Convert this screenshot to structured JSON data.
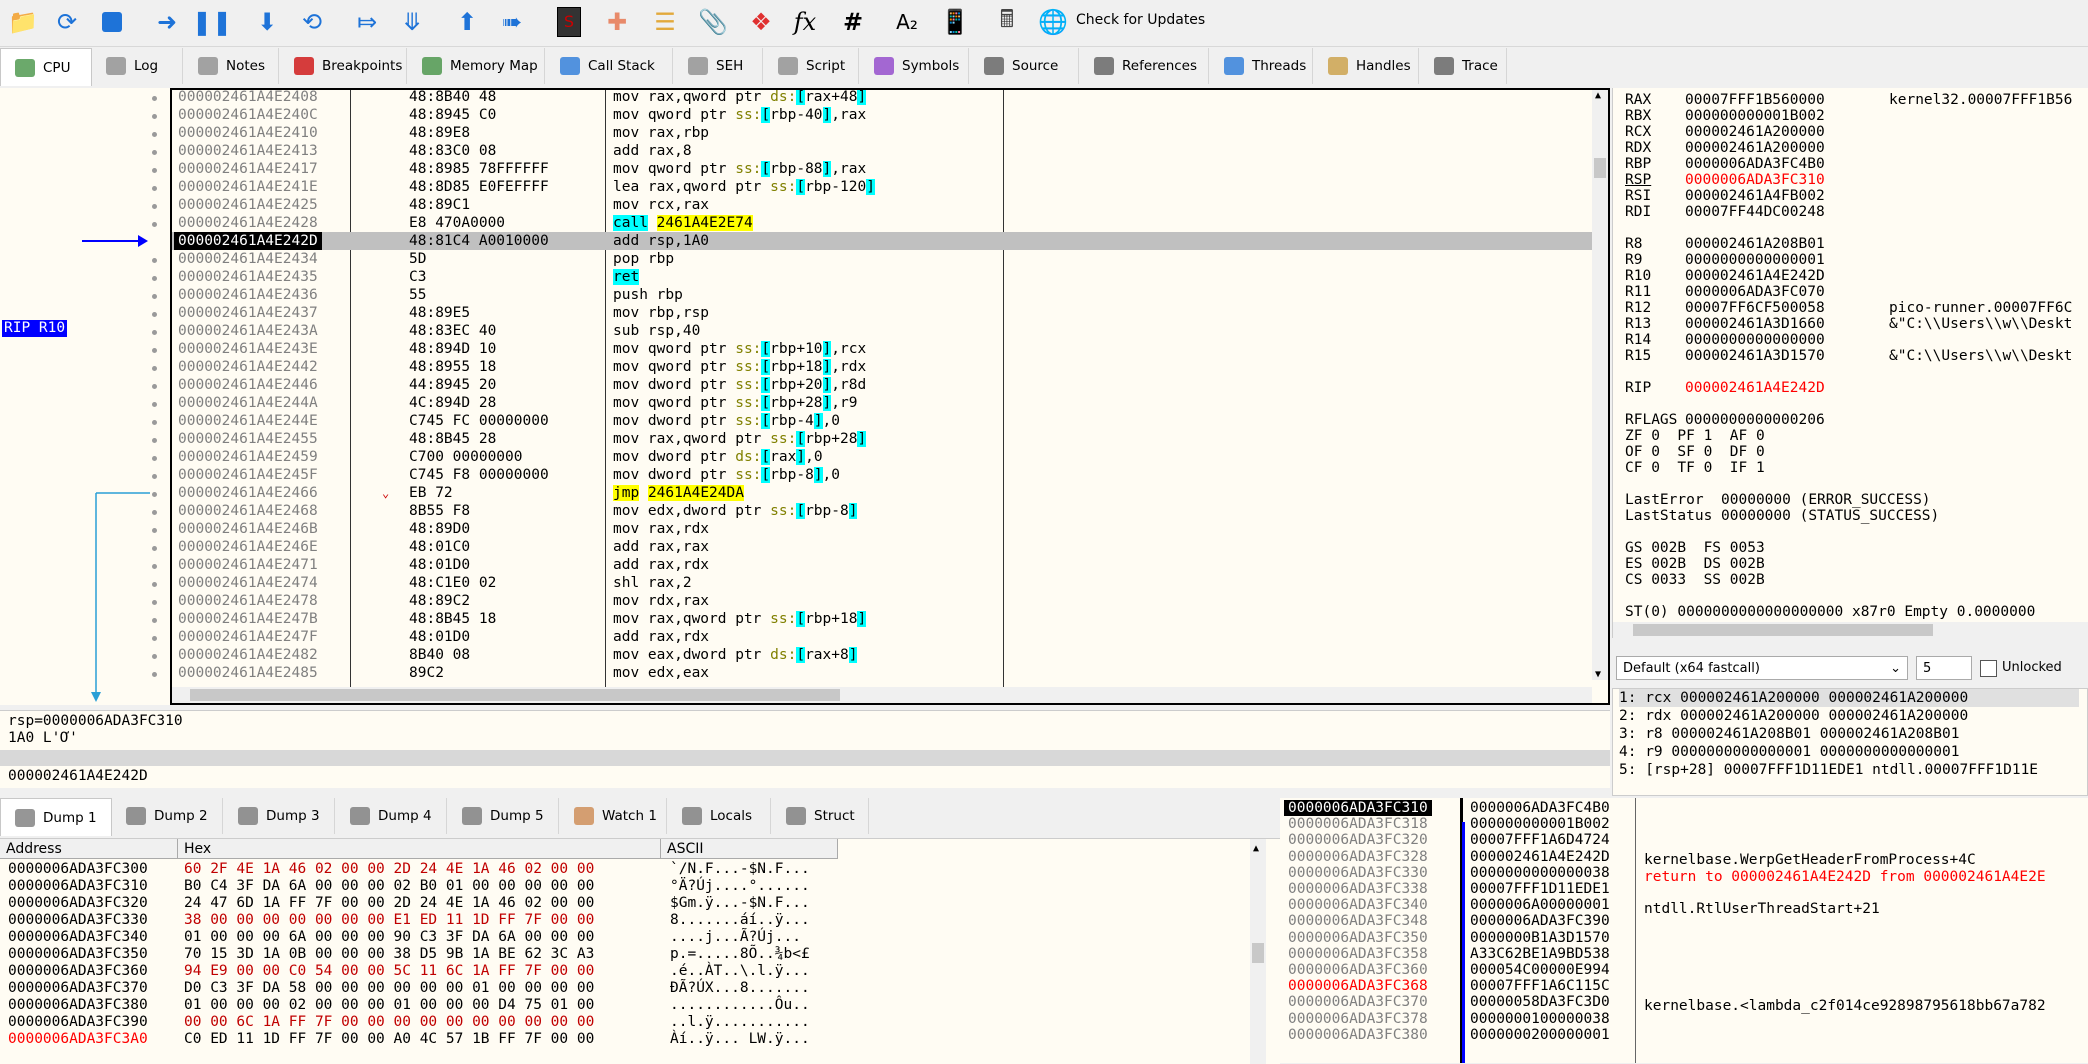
{
  "toolbar": {
    "check_updates_label": "Check for Updates",
    "icons": [
      "open-icon",
      "restart-icon",
      "stop-icon",
      "run-icon",
      "pause-icon",
      "step-into-icon",
      "step-over-icon",
      "trace-into-icon",
      "trace-over-icon",
      "execute-till-return-icon",
      "run-to-user-code-icon",
      "scylla-icon",
      "patches-icon",
      "comments-icon",
      "labels-icon",
      "bookmarks-icon",
      "functions-icon",
      "hash-icon",
      "font-icon",
      "calculator-icon",
      "update-icon"
    ]
  },
  "tabs": [
    {
      "label": "CPU",
      "icon": "cpu-icon",
      "active": true
    },
    {
      "label": "Log",
      "icon": "log-icon"
    },
    {
      "label": "Notes",
      "icon": "notes-icon"
    },
    {
      "label": "Breakpoints",
      "icon": "breakpoint-icon"
    },
    {
      "label": "Memory Map",
      "icon": "memory-map-icon"
    },
    {
      "label": "Call Stack",
      "icon": "call-stack-icon"
    },
    {
      "label": "SEH",
      "icon": "seh-icon"
    },
    {
      "label": "Script",
      "icon": "script-icon"
    },
    {
      "label": "Symbols",
      "icon": "symbols-icon"
    },
    {
      "label": "Source",
      "icon": "source-icon"
    },
    {
      "label": "References",
      "icon": "references-icon"
    },
    {
      "label": "Threads",
      "icon": "threads-icon"
    },
    {
      "label": "Handles",
      "icon": "handles-icon"
    },
    {
      "label": "Trace",
      "icon": "trace-icon"
    }
  ],
  "rip_label": "RIP R10",
  "disasm": [
    {
      "addr": "000002461A4E2408",
      "bytes": "48:8B40 48",
      "ins": "mov rax,qword ptr ds:[rax+48]"
    },
    {
      "addr": "000002461A4E240C",
      "bytes": "48:8945 C0",
      "ins": "mov qword ptr ss:[rbp-40],rax"
    },
    {
      "addr": "000002461A4E2410",
      "bytes": "48:89E8",
      "ins": "mov rax,rbp"
    },
    {
      "addr": "000002461A4E2413",
      "bytes": "48:83C0 08",
      "ins": "add rax,8"
    },
    {
      "addr": "000002461A4E2417",
      "bytes": "48:8985 78FFFFFF",
      "ins": "mov qword ptr ss:[rbp-88],rax"
    },
    {
      "addr": "000002461A4E241E",
      "bytes": "48:8D85 E0FEFFFF",
      "ins": "lea rax,qword ptr ss:[rbp-120]"
    },
    {
      "addr": "000002461A4E2425",
      "bytes": "48:89C1",
      "ins": "mov rcx,rax"
    },
    {
      "addr": "000002461A4E2428",
      "bytes": "E8 470A0000",
      "ins": "call 2461A4E2E74"
    },
    {
      "addr": "000002461A4E242D",
      "bytes": "48:81C4 A0010000",
      "ins": "add rsp,1A0",
      "current": true
    },
    {
      "addr": "000002461A4E2434",
      "bytes": "5D",
      "ins": "pop rbp"
    },
    {
      "addr": "000002461A4E2435",
      "bytes": "C3",
      "ins": "ret"
    },
    {
      "addr": "000002461A4E2436",
      "bytes": "55",
      "ins": "push rbp"
    },
    {
      "addr": "000002461A4E2437",
      "bytes": "48:89E5",
      "ins": "mov rbp,rsp"
    },
    {
      "addr": "000002461A4E243A",
      "bytes": "48:83EC 40",
      "ins": "sub rsp,40"
    },
    {
      "addr": "000002461A4E243E",
      "bytes": "48:894D 10",
      "ins": "mov qword ptr ss:[rbp+10],rcx"
    },
    {
      "addr": "000002461A4E2442",
      "bytes": "48:8955 18",
      "ins": "mov qword ptr ss:[rbp+18],rdx"
    },
    {
      "addr": "000002461A4E2446",
      "bytes": "44:8945 20",
      "ins": "mov dword ptr ss:[rbp+20],r8d"
    },
    {
      "addr": "000002461A4E244A",
      "bytes": "4C:894D 28",
      "ins": "mov qword ptr ss:[rbp+28],r9"
    },
    {
      "addr": "000002461A4E244E",
      "bytes": "C745 FC 00000000",
      "ins": "mov dword ptr ss:[rbp-4],0"
    },
    {
      "addr": "000002461A4E2455",
      "bytes": "48:8B45 28",
      "ins": "mov rax,qword ptr ss:[rbp+28]"
    },
    {
      "addr": "000002461A4E2459",
      "bytes": "C700 00000000",
      "ins": "mov dword ptr ds:[rax],0"
    },
    {
      "addr": "000002461A4E245F",
      "bytes": "C745 F8 00000000",
      "ins": "mov dword ptr ss:[rbp-8],0"
    },
    {
      "addr": "000002461A4E2466",
      "bytes": "EB 72",
      "ins": "jmp 2461A4E24DA"
    },
    {
      "addr": "000002461A4E2468",
      "bytes": "8B55 F8",
      "ins": "mov edx,dword ptr ss:[rbp-8]"
    },
    {
      "addr": "000002461A4E246B",
      "bytes": "48:89D0",
      "ins": "mov rax,rdx"
    },
    {
      "addr": "000002461A4E246E",
      "bytes": "48:01C0",
      "ins": "add rax,rax"
    },
    {
      "addr": "000002461A4E2471",
      "bytes": "48:01D0",
      "ins": "add rax,rdx"
    },
    {
      "addr": "000002461A4E2474",
      "bytes": "48:C1E0 02",
      "ins": "shl rax,2"
    },
    {
      "addr": "000002461A4E2478",
      "bytes": "48:89C2",
      "ins": "mov rdx,rax"
    },
    {
      "addr": "000002461A4E247B",
      "bytes": "48:8B45 18",
      "ins": "mov rax,qword ptr ss:[rbp+18]"
    },
    {
      "addr": "000002461A4E247F",
      "bytes": "48:01D0",
      "ins": "add rax,rdx"
    },
    {
      "addr": "000002461A4E2482",
      "bytes": "8B40 08",
      "ins": "mov eax,dword ptr ds:[rax+8]"
    },
    {
      "addr": "000002461A4E2485",
      "bytes": "89C2",
      "ins": "mov edx,eax"
    }
  ],
  "registers": {
    "general": [
      {
        "name": "RAX",
        "value": "00007FFF1B560000",
        "comment": "kernel32.00007FFF1B56"
      },
      {
        "name": "RBX",
        "value": "000000000001B002",
        "comment": ""
      },
      {
        "name": "RCX",
        "value": "000002461A200000",
        "comment": ""
      },
      {
        "name": "RDX",
        "value": "000002461A200000",
        "comment": ""
      },
      {
        "name": "RBP",
        "value": "0000006ADA3FC4B0",
        "comment": ""
      },
      {
        "name": "RSP",
        "value": "0000006ADA3FC310",
        "comment": "",
        "changed": true
      },
      {
        "name": "RSI",
        "value": "000002461A4FB002",
        "comment": ""
      },
      {
        "name": "RDI",
        "value": "00007FF44DC00248",
        "comment": ""
      }
    ],
    "extended": [
      {
        "name": "R8",
        "value": "000002461A208B01",
        "comment": ""
      },
      {
        "name": "R9",
        "value": "0000000000000001",
        "comment": ""
      },
      {
        "name": "R10",
        "value": "000002461A4E242D",
        "comment": ""
      },
      {
        "name": "R11",
        "value": "0000006ADA3FC070",
        "comment": ""
      },
      {
        "name": "R12",
        "value": "00007FF6CF500058",
        "comment": "pico-runner.00007FF6C"
      },
      {
        "name": "R13",
        "value": "000002461A3D1660",
        "comment": "&\"C:\\\\Users\\\\w\\\\Deskt"
      },
      {
        "name": "R14",
        "value": "0000000000000000",
        "comment": ""
      },
      {
        "name": "R15",
        "value": "000002461A3D1570",
        "comment": "&\"C:\\\\Users\\\\w\\\\Deskt"
      }
    ],
    "rip": {
      "name": "RIP",
      "value": "000002461A4E242D"
    },
    "rflags": {
      "name": "RFLAGS",
      "value": "0000000000000206"
    },
    "flags_line1": "ZF 0  PF 1  AF 0",
    "flags_line2": "OF 0  SF 0  DF 0",
    "flags_line3": "CF 0  TF 0  IF 1",
    "last_error": "LastError  00000000 (ERROR_SUCCESS)",
    "last_status": "LastStatus 00000000 (STATUS_SUCCESS)",
    "seg1": "GS 002B  FS 0053",
    "seg2": "ES 002B  DS 002B",
    "seg3": "CS 0033  SS 002B",
    "st0": "ST(0) 0000000000000000000 x87r0 Empty 0.0000000"
  },
  "callconv": {
    "selected": "Default (x64 fastcall)",
    "count": "5",
    "unlocked_label": "Unlocked"
  },
  "args": [
    "1: rcx 000002461A200000 000002461A200000",
    "2: rdx 000002461A200000 000002461A200000",
    "3: r8 000002461A208B01 000002461A208B01",
    "4: r9 0000000000000001 0000000000000001",
    "5: [rsp+28] 00007FFF1D11EDE1 ntdll.00007FFF1D11E"
  ],
  "info": {
    "line1": "rsp=0000006ADA3FC310",
    "line2": "1A0 L'Ơ'",
    "address": "000002461A4E242D"
  },
  "dump_tabs": [
    {
      "label": "Dump 1",
      "icon": "dump-icon",
      "active": true
    },
    {
      "label": "Dump 2",
      "icon": "dump-icon"
    },
    {
      "label": "Dump 3",
      "icon": "dump-icon"
    },
    {
      "label": "Dump 4",
      "icon": "dump-icon"
    },
    {
      "label": "Dump 5",
      "icon": "dump-icon"
    },
    {
      "label": "Watch 1",
      "icon": "watch-icon"
    },
    {
      "label": "Locals",
      "icon": "locals-icon"
    },
    {
      "label": "Struct",
      "icon": "struct-icon"
    }
  ],
  "dump": {
    "headers": {
      "address": "Address",
      "hex": "Hex",
      "ascii": "ASCII"
    },
    "rows": [
      {
        "addr": "0000006ADA3FC300",
        "hex": "60 2F 4E 1A 46 02 00 00 2D 24 4E 1A 46 02 00 00",
        "ascii": "`/N.F...-$N.F..."
      },
      {
        "addr": "0000006ADA3FC310",
        "hex": "B0 C4 3F DA 6A 00 00 00 02 B0 01 00 00 00 00 00",
        "ascii": "°Ä?Új....°......"
      },
      {
        "addr": "0000006ADA3FC320",
        "hex": "24 47 6D 1A FF 7F 00 00 2D 24 4E 1A 46 02 00 00",
        "ascii": "$Gm.ÿ...-$N.F..."
      },
      {
        "addr": "0000006ADA3FC330",
        "hex": "38 00 00 00 00 00 00 00 E1 ED 11 1D FF 7F 00 00",
        "ascii": "8.......áí..ÿ..."
      },
      {
        "addr": "0000006ADA3FC340",
        "hex": "01 00 00 00 6A 00 00 00 90 C3 3F DA 6A 00 00 00",
        "ascii": "....j...Ã?Új..."
      },
      {
        "addr": "0000006ADA3FC350",
        "hex": "70 15 3D 1A 0B 00 00 00 38 D5 9B 1A BE 62 3C A3",
        "ascii": "p.=.....8Õ..¾b<£"
      },
      {
        "addr": "0000006ADA3FC360",
        "hex": "94 E9 00 00 C0 54 00 00 5C 11 6C 1A FF 7F 00 00",
        "ascii": ".é..ÀT..\\.l.ÿ..."
      },
      {
        "addr": "0000006ADA3FC370",
        "hex": "D0 C3 3F DA 58 00 00 00 00 00 00 01 00 00 00 00",
        "ascii": "ÐÃ?ÚX...8......."
      },
      {
        "addr": "0000006ADA3FC380",
        "hex": "01 00 00 00 02 00 00 00 01 00 00 00 D4 75 01 00",
        "ascii": "............Ôu.."
      },
      {
        "addr": "0000006ADA3FC390",
        "hex": "00 00 6C 1A FF 7F 00 00 00 00 00 00 00 00 00 00",
        "ascii": "..l.ÿ..........."
      },
      {
        "addr": "0000006ADA3FC3A0",
        "hex": "C0 ED 11 1D FF 7F 00 00 A0 4C 57 1B FF 7F 00 00",
        "ascii": "Àí..ÿ... LW.ÿ...",
        "red": true
      }
    ]
  },
  "stack": {
    "rows": [
      {
        "addr": "0000006ADA3FC310",
        "value": "0000006ADA3FC4B0",
        "comment": "",
        "current": true
      },
      {
        "addr": "0000006ADA3FC318",
        "value": "000000000001B002",
        "comment": ""
      },
      {
        "addr": "0000006ADA3FC320",
        "value": "00007FFF1A6D4724",
        "comment": "kernelbase.WerpGetHeaderFromProcess+4C"
      },
      {
        "addr": "0000006ADA3FC328",
        "value": "000002461A4E242D",
        "comment": "return to 000002461A4E242D from 000002461A4E2E"
      },
      {
        "addr": "0000006ADA3FC330",
        "value": "0000000000000038",
        "comment": ""
      },
      {
        "addr": "0000006ADA3FC338",
        "value": "00007FFF1D11EDE1",
        "comment": "ntdll.RtlUserThreadStart+21"
      },
      {
        "addr": "0000006ADA3FC340",
        "value": "0000006A00000001",
        "comment": ""
      },
      {
        "addr": "0000006ADA3FC348",
        "value": "0000006ADA3FC390",
        "comment": ""
      },
      {
        "addr": "0000006ADA3FC350",
        "value": "0000000B1A3D1570",
        "comment": ""
      },
      {
        "addr": "0000006ADA3FC358",
        "value": "A33C62BE1A9BD538",
        "comment": ""
      },
      {
        "addr": "0000006ADA3FC360",
        "value": "000054C00000E994",
        "comment": ""
      },
      {
        "addr": "0000006ADA3FC368",
        "value": "00007FFF1A6C115C",
        "comment": "kernelbase.<lambda_c2f014ce92898795618bb67a782",
        "red": true
      },
      {
        "addr": "0000006ADA3FC370",
        "value": "00000058DA3FC3D0",
        "comment": ""
      },
      {
        "addr": "0000006ADA3FC378",
        "value": "0000000100000038",
        "comment": ""
      },
      {
        "addr": "0000006ADA3FC380",
        "value": "0000000200000001",
        "comment": ""
      }
    ]
  }
}
